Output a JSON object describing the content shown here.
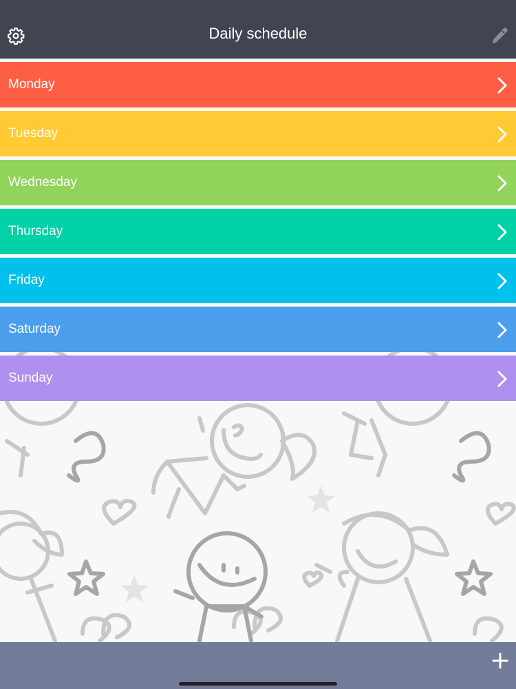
{
  "header": {
    "title": "Daily schedule",
    "left_icon": "gear-icon",
    "right_icon": "pencil-icon"
  },
  "days": [
    {
      "label": "Monday",
      "color": "#FF5F45"
    },
    {
      "label": "Tuesday",
      "color": "#FFCA33"
    },
    {
      "label": "Wednesday",
      "color": "#91D35B"
    },
    {
      "label": "Thursday",
      "color": "#00D1A7"
    },
    {
      "label": "Friday",
      "color": "#00C1EC"
    },
    {
      "label": "Saturday",
      "color": "#4A9EEC"
    },
    {
      "label": "Sunday",
      "color": "#B090EE"
    }
  ],
  "footer": {
    "add_icon": "plus-icon"
  },
  "colors": {
    "navbar": "#414552",
    "bottombar": "#727C98",
    "background": "#F8F8F8"
  }
}
